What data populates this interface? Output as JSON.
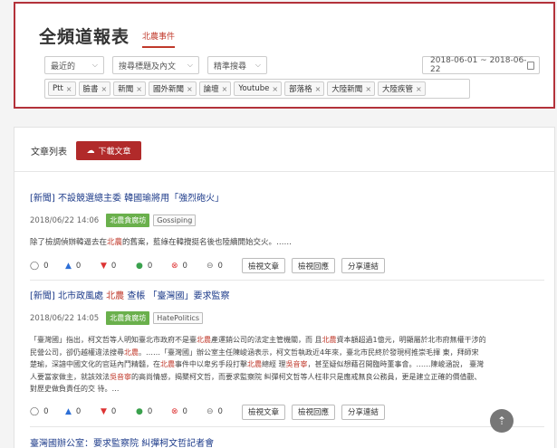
{
  "report": {
    "title": "全頻道報表",
    "active_tab": "北農事件",
    "filters": {
      "time_select": "最近的",
      "search_scope_select": "搜尋標題及內文",
      "search_mode_select": "精準搜尋",
      "date_range": "2018-06-01 ~ 2018-06-22"
    },
    "source_tags": [
      "Ptt",
      "臉書",
      "新聞",
      "國外新聞",
      "論壇",
      "Youtube",
      "部落格",
      "大陸新聞",
      "大陸疾管"
    ]
  },
  "article_list": {
    "title": "文章列表",
    "download_label": "下載文章",
    "action_buttons": {
      "view": "檢視文章",
      "view_replies": "檢視回應",
      "share": "分享連結"
    },
    "articles": [
      {
        "title_before": "[新聞] 不設競選總主委 韓國瑜將用「強烈砲火」",
        "title_hl": "",
        "title_after": "",
        "date": "2018/06/22 14:06",
        "topic_badge": "北農貪腐坊",
        "board": "Gossiping",
        "snippet_before": "除了檢調偵辦韓逼去在",
        "snippet_hl": "北農",
        "snippet_after": "的舊案，藍綠在韓攪挺名後也陸續開始交火。……",
        "stats": {
          "comments": "0",
          "likes": "0",
          "dislikes": "0",
          "positive": "0",
          "negative": "0",
          "neutral": "0"
        }
      },
      {
        "title_before": "[新聞] 北市政風處 ",
        "title_hl": "北農",
        "title_after": " 查帳 「臺灣國」要求監察",
        "date": "2018/06/22 14:05",
        "topic_badge": "北農貪腐坊",
        "board": "HatePolitics",
        "snippet_line1_a": "「臺灣國」指出，柯文哲等人明知臺北市政府不是臺",
        "snippet_line1_hl": "北農",
        "snippet_line1_b": "產運銷公司的法定主管機關，而 且",
        "snippet_line1_hl2": "北農",
        "snippet_line1_c": "資本額超過1億元，明顯屬於北市府無權干涉的",
        "snippet_line2_a": "民營公司，卻仍越權違法搜尋",
        "snippet_line2_hl": "北農",
        "snippet_line2_b": "。……「臺灣國」辦公室主任陳峻涵表示，柯文哲執政近4年來，臺北市民終於發現柯推崇毛揮 東，拜師宋",
        "snippet_line3_a": "楚瑜，深諳中國文化的官廷內鬥精髓，在",
        "snippet_line3_hl": "北農",
        "snippet_line3_b": "事件中以卑劣手段打擊",
        "snippet_line3_hl2": "北農",
        "snippet_line3_c": "總經 理",
        "snippet_line3_hl3": "吳音寧",
        "snippet_line3_d": "，甚至疑似想藉召開臨時董事會。……陳峻涵說， 臺灣",
        "snippet_line4_a": "人要當家做主，就該效法",
        "snippet_line4_hl": "吳音寧",
        "snippet_line4_b": "的高尚情感，揭櫫柯文哲，而要求監察院 糾彈柯文哲等人枉非只是應戒無良公務員，更是建立正確的價值觀、",
        "snippet_line5": "對歷史做負責任的交 待。…",
        "stats": {
          "comments": "0",
          "likes": "0",
          "dislikes": "0",
          "positive": "0",
          "negative": "0",
          "neutral": "0"
        }
      },
      {
        "title_before": "臺灣國辦公室：要求監察院 糾彈柯文哲記者會",
        "title_hl": "",
        "title_after": ""
      }
    ]
  },
  "colors": {
    "accent_red": "#b12a2a",
    "link_blue": "#1d3b8a",
    "badge_green": "#6ab04c"
  },
  "icons": [
    "calendar-icon",
    "cloud-download-icon",
    "comment-icon",
    "thumbs-up-icon",
    "thumbs-down-icon",
    "check-circle-icon",
    "x-circle-icon",
    "neutral-icon",
    "arrow-up-icon"
  ]
}
